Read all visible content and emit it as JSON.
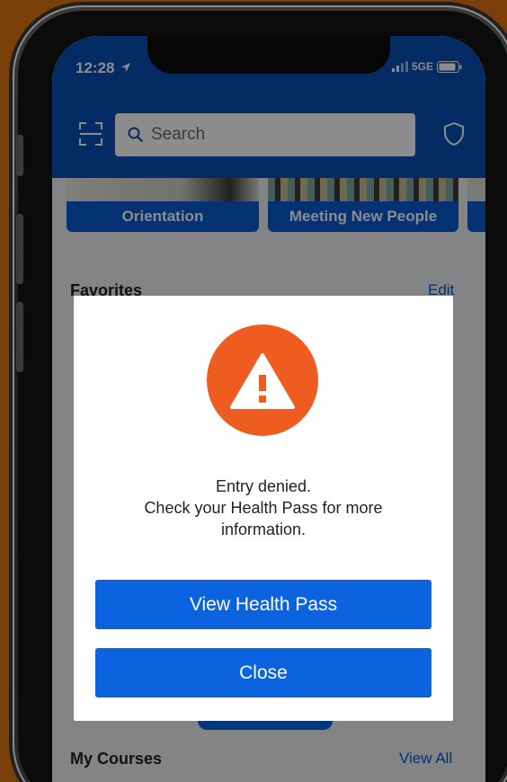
{
  "status_bar": {
    "time": "12:28",
    "network": "5GE"
  },
  "header": {
    "search_placeholder": "Search"
  },
  "categories": [
    {
      "label": "Orientation"
    },
    {
      "label": "Meeting New People"
    }
  ],
  "favorites": {
    "title": "Favorites",
    "edit_label": "Edit"
  },
  "my_courses": {
    "title": "My Courses",
    "view_all_label": "View All"
  },
  "modal": {
    "line1": "Entry denied.",
    "line2": "Check your Health Pass for more",
    "line3": "information.",
    "primary_button": "View Health Pass",
    "secondary_button": "Close"
  },
  "colors": {
    "header_blue": "#0a4fb8",
    "button_blue": "#0b63e0",
    "warning_orange": "#ee5d1f",
    "backdrop": "#7a3f0b"
  },
  "icons": {
    "scan": "scan-icon",
    "search": "search-icon",
    "shield": "shield-icon",
    "warning": "warning-icon",
    "location": "location-arrow-icon",
    "signal": "signal-icon",
    "battery": "battery-icon"
  }
}
